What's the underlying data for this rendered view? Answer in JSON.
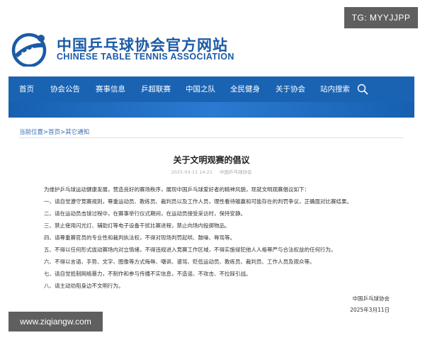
{
  "watermark_top": "TG: MYYJJPP",
  "watermark_bottom": "www.ziqiangw.com",
  "site": {
    "name_cn": "中国乒乓球协会官方网站",
    "name_en": "CHINESE TABLE TENNIS ASSOCIATION"
  },
  "nav": {
    "items": [
      "首页",
      "协会公告",
      "赛事信息",
      "乒超联赛",
      "中国之队",
      "全民健身",
      "关于协会",
      "站内搜索"
    ]
  },
  "breadcrumb": {
    "prefix": "当前位置",
    "sep": ">",
    "items": [
      "首页",
      "其它通知"
    ]
  },
  "article": {
    "title": "关于文明观赛的倡议",
    "datetime": "2025-03-11 14:21",
    "source": "中国乒乓球协会",
    "intro": "为维护乒乓球运动健康发展，营造良好的赛场秩序，展现中国乒乓球爱好者的精神风貌，现就文明观赛倡议如下：",
    "items": [
      "一、请自觉遵守竞赛规则，尊重运动员、教练员、裁判员以及工作人员，理性看待输赢和可能存在的判罚争议，正确面对比赛结果。",
      "二、请在运动员击球过程中，在赛事举行仪式期间，在运动员接受采访时，保持安静。",
      "三、禁止使用闪光灯、辅助灯等电子设备干扰比赛进程，禁止向场内投掷物品。",
      "四、请尊重赛官员的专业性和裁判执法权，不得对现场判罚起哄、鼓噪、辱骂等。",
      "五、不得以任何形式拢动赛场内对立情绪，不得违规进入竞赛工作区域，不得实施侵犯他人人格尊严与合法权益的任何行为。",
      "六、不得以言语、手势、文字、图像等方式侮辱、嘲讽、谩骂、贬低运动员、教练员、裁判员、工作人员及观众等。",
      "七、请自觉抵制网络暴力，不制作和参与传播不实信息，不造谣、不攻击、不拉踩引战。",
      "八、请主动劝阻身边不文明行为。"
    ],
    "signature": "中国乒乓球协会",
    "date": "2025年3月11日"
  }
}
